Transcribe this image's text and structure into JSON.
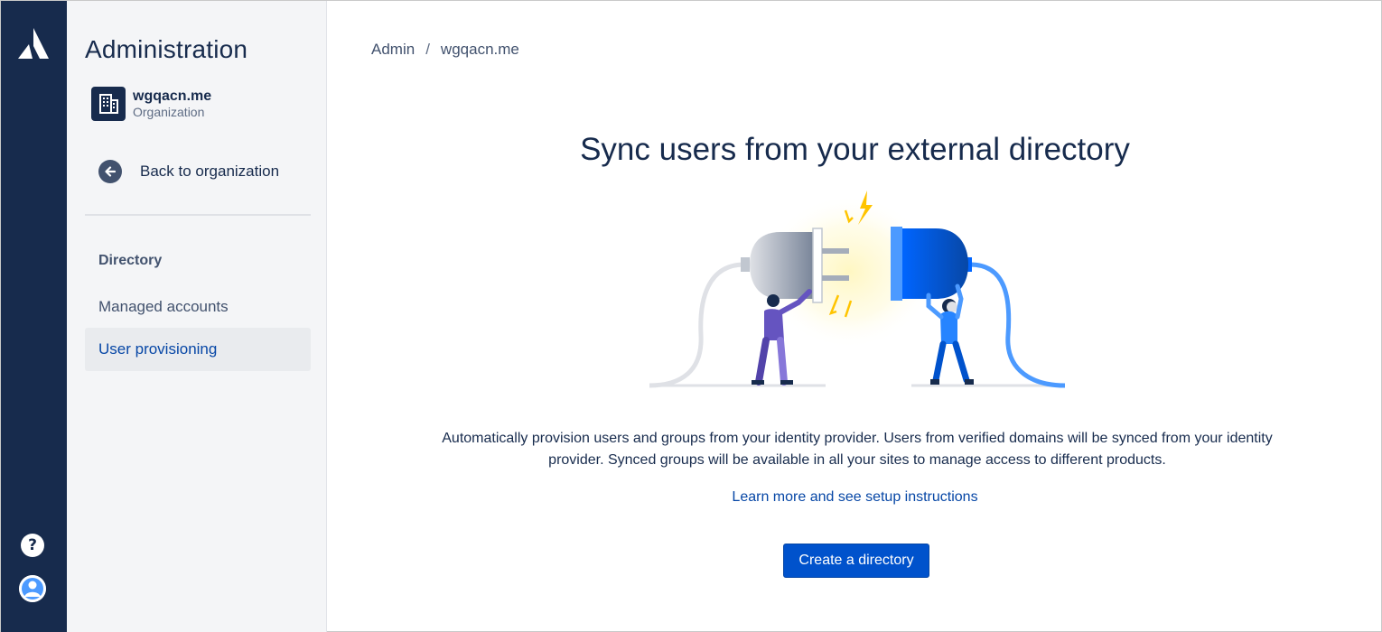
{
  "nav_rail": {
    "logo_icon": "atlassian-logo-icon",
    "help_icon": "help-icon",
    "help_glyph": "?",
    "profile_icon": "profile-avatar-icon"
  },
  "sidebar": {
    "title": "Administration",
    "organization": {
      "icon": "building-icon",
      "name": "wgqacn.me",
      "type": "Organization"
    },
    "back_label": "Back to organization",
    "section_heading": "Directory",
    "items": [
      {
        "label": "Managed accounts",
        "selected": false
      },
      {
        "label": "User provisioning",
        "selected": true
      }
    ]
  },
  "breadcrumb": {
    "items": [
      "Admin",
      "wgqacn.me"
    ],
    "separator": "/"
  },
  "main": {
    "title": "Sync users from your external directory",
    "illustration_icon": "plug-connection-illustration",
    "description": "Automatically provision users and groups from your identity provider. Users from verified domains will be synced from your identity provider. Synced groups will be available in all your sites to manage access to different products.",
    "learn_more": "Learn more and see setup instructions",
    "cta_label": "Create a directory"
  },
  "colors": {
    "nav_rail": "#172b4d",
    "sidebar_bg": "#f4f5f7",
    "selected_bg": "#e9ebee",
    "link": "#0747a6",
    "primary_button": "#0052cc"
  }
}
